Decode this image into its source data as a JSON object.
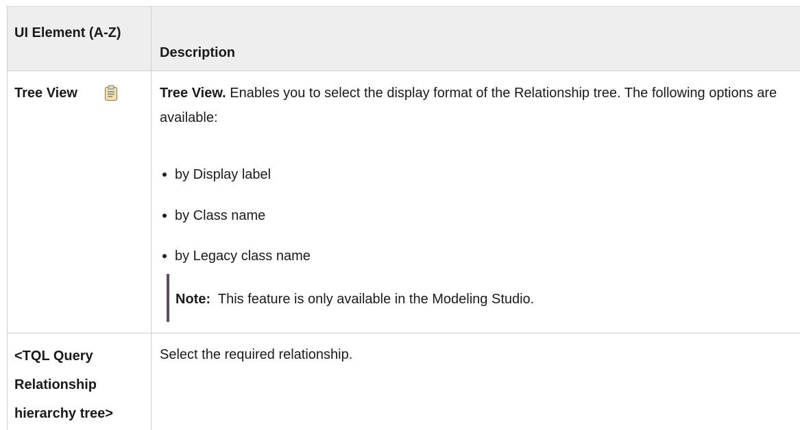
{
  "table": {
    "headers": {
      "col1": "UI Element (A-Z)",
      "col2": "Description"
    },
    "rows": [
      {
        "element": "Tree View",
        "icon": "tree-view-icon",
        "description_lead": "Tree View.",
        "description_text": " Enables you to select the display format of the Relationship tree. The following options are available:",
        "options": [
          "by Display label",
          "by Class name",
          "by Legacy class name"
        ],
        "note_label": "Note:",
        "note_text": "  This feature is only available in the Modeling Studio."
      },
      {
        "element": "<TQL Query Relationship hierarchy tree>",
        "description_text": "Select the required relationship."
      }
    ]
  },
  "colors": {
    "header_bg": "#eeeeee",
    "grid_line": "#cfcfcf",
    "note_bar": "#5e4a63",
    "icon_fill": "#f5e0a0",
    "text": "#1a1a1a"
  }
}
